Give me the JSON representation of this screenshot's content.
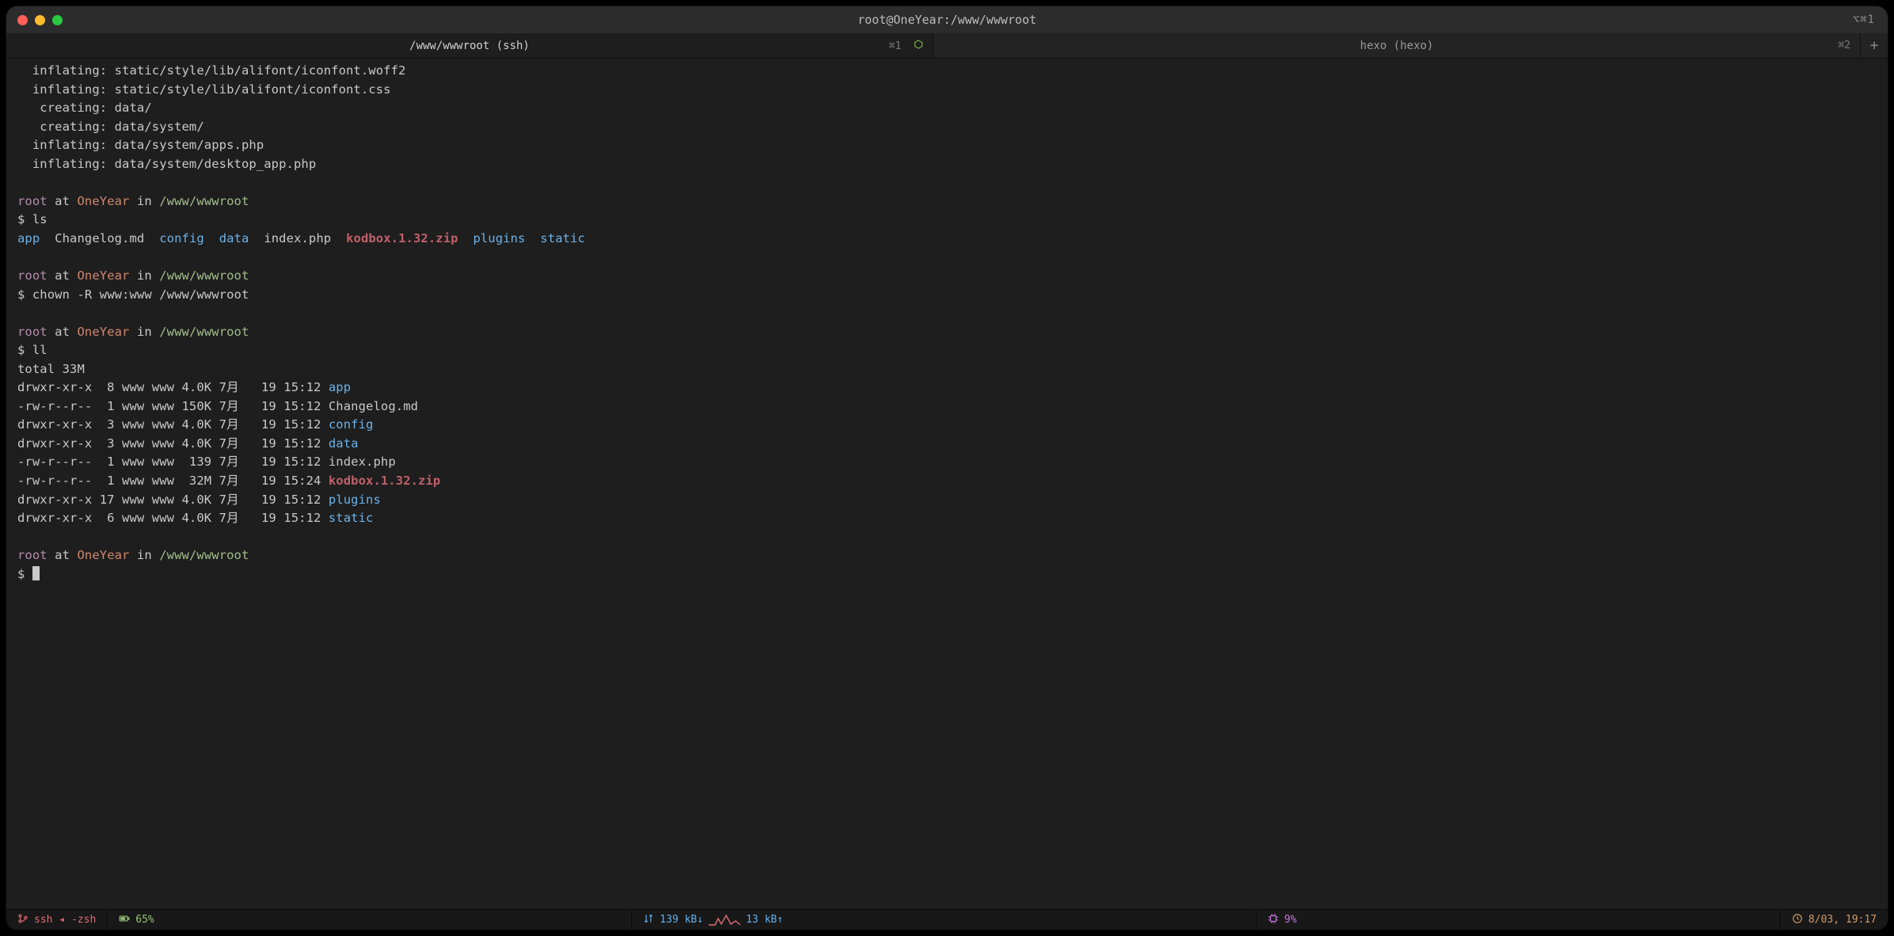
{
  "window": {
    "title": "root@OneYear:/www/wwwroot",
    "title_shortcut": "⌥⌘1"
  },
  "tabs": [
    {
      "label": "/www/wwwroot (ssh)",
      "shortcut": "⌘1",
      "active": true,
      "icon": "node-icon"
    },
    {
      "label": "hexo (hexo)",
      "shortcut": "⌘2",
      "active": false,
      "icon": ""
    }
  ],
  "terminal": {
    "unzip_lines": [
      "  inflating: static/style/lib/alifont/iconfont.woff2",
      "  inflating: static/style/lib/alifont/iconfont.css",
      "   creating: data/",
      "   creating: data/system/",
      "  inflating: data/system/apps.php",
      "  inflating: data/system/desktop_app.php"
    ],
    "prompt": {
      "user": "root",
      "at": " at ",
      "host": "OneYear",
      "in": " in ",
      "path": "/www/wwwroot"
    },
    "cmd_ls": "ls",
    "ls_items": [
      {
        "text": "app",
        "cls": "c-dir2"
      },
      {
        "text": "Changelog.md",
        "cls": "c-plain"
      },
      {
        "text": "config",
        "cls": "c-dir2"
      },
      {
        "text": "data",
        "cls": "c-dir2"
      },
      {
        "text": "index.php",
        "cls": "c-plain"
      },
      {
        "text": "kodbox.1.32.zip",
        "cls": "c-zip"
      },
      {
        "text": "plugins",
        "cls": "c-dir2"
      },
      {
        "text": "static",
        "cls": "c-dir2"
      }
    ],
    "cmd_chown": "chown -R www:www /www/wwwroot",
    "cmd_ll": "ll",
    "ll_total": "total 33M",
    "ll_rows": [
      {
        "perm": "drwxr-xr-x",
        "ln": " 8",
        "own": "www www",
        "size": "4.0K",
        "date": "7月   19 15:12",
        "name": "app",
        "cls": "c-dir2"
      },
      {
        "perm": "-rw-r--r--",
        "ln": " 1",
        "own": "www www",
        "size": "150K",
        "date": "7月   19 15:12",
        "name": "Changelog.md",
        "cls": "c-plain"
      },
      {
        "perm": "drwxr-xr-x",
        "ln": " 3",
        "own": "www www",
        "size": "4.0K",
        "date": "7月   19 15:12",
        "name": "config",
        "cls": "c-dir2"
      },
      {
        "perm": "drwxr-xr-x",
        "ln": " 3",
        "own": "www www",
        "size": "4.0K",
        "date": "7月   19 15:12",
        "name": "data",
        "cls": "c-dir2"
      },
      {
        "perm": "-rw-r--r--",
        "ln": " 1",
        "own": "www www",
        "size": " 139",
        "date": "7月   19 15:12",
        "name": "index.php",
        "cls": "c-plain"
      },
      {
        "perm": "-rw-r--r--",
        "ln": " 1",
        "own": "www www",
        "size": " 32M",
        "date": "7月   19 15:24",
        "name": "kodbox.1.32.zip",
        "cls": "c-zip"
      },
      {
        "perm": "drwxr-xr-x",
        "ln": "17",
        "own": "www www",
        "size": "4.0K",
        "date": "7月   19 15:12",
        "name": "plugins",
        "cls": "c-dir2"
      },
      {
        "perm": "drwxr-xr-x",
        "ln": " 6",
        "own": "www www",
        "size": "4.0K",
        "date": "7月   19 15:12",
        "name": "static",
        "cls": "c-dir2"
      }
    ]
  },
  "status": {
    "session": "ssh ◂ -zsh",
    "battery": "65%",
    "net_down": "139 kB↓",
    "net_up": "13 kB↑",
    "cpu": "9%",
    "clock": "8/03, 19:17"
  }
}
